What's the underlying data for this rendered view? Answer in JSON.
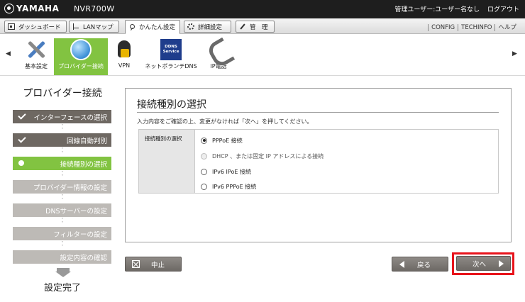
{
  "header": {
    "brand": "YAMAHA",
    "model": "NVR700W",
    "user": "管理ユーザー:ユーザー名なし",
    "logout": "ログアウト"
  },
  "tabs": [
    {
      "label": "ダッシュボード",
      "icon": "dashboard-icon"
    },
    {
      "label": "LANマップ",
      "icon": "lan-map-icon"
    },
    {
      "label": "かんたん設定",
      "icon": "easy-setup-icon",
      "active": true
    },
    {
      "label": "詳細設定",
      "icon": "gear-icon"
    },
    {
      "label": "管　理",
      "icon": "wrench-icon"
    }
  ],
  "top_links": [
    "CONFIG",
    "TECHINFO",
    "ヘルプ"
  ],
  "nav": {
    "items": [
      {
        "label": "基本設定",
        "icon": "tools-icon"
      },
      {
        "label": "プロバイダー接続",
        "icon": "globe-icon",
        "active": true
      },
      {
        "label": "VPN",
        "icon": "vpn-lock-icon"
      },
      {
        "label": "ネットボランチDNS",
        "icon": "ddns-icon",
        "icon_text": [
          "DDNS",
          "Service"
        ]
      },
      {
        "label": "IP電話",
        "icon": "phone-icon"
      }
    ]
  },
  "steps": {
    "title": "プロバイダー接続",
    "items": [
      {
        "label": "インターフェースの選択",
        "state": "done"
      },
      {
        "label": "回線自動判別",
        "state": "done"
      },
      {
        "label": "接続種別の選択",
        "state": "current"
      },
      {
        "label": "プロバイダー情報の設定",
        "state": "pending"
      },
      {
        "label": "DNSサーバーの設定",
        "state": "pending"
      },
      {
        "label": "フィルターの設定",
        "state": "pending"
      },
      {
        "label": "設定内容の確認",
        "state": "pending"
      }
    ],
    "final": "設定完了"
  },
  "main": {
    "title": "接続種別の選択",
    "instruction": "入力内容をご確認の上、変更がなければ「次へ」を押してください。",
    "field_label": "接続種別の選択",
    "options": [
      {
        "label": "PPPoE 接続",
        "checked": true,
        "disabled": false
      },
      {
        "label": "DHCP 、または固定 IP アドレスによる接続",
        "checked": false,
        "disabled": true
      },
      {
        "label": "IPv6 IPoE 接続",
        "checked": false,
        "disabled": false
      },
      {
        "label": "IPv6 PPPoE 接続",
        "checked": false,
        "disabled": false
      }
    ]
  },
  "buttons": {
    "cancel": "中止",
    "back": "戻る",
    "next": "次へ"
  },
  "colors": {
    "accent_green": "#82c341",
    "highlight_red": "#e8141c",
    "header_bg": "#1e1e1e"
  }
}
